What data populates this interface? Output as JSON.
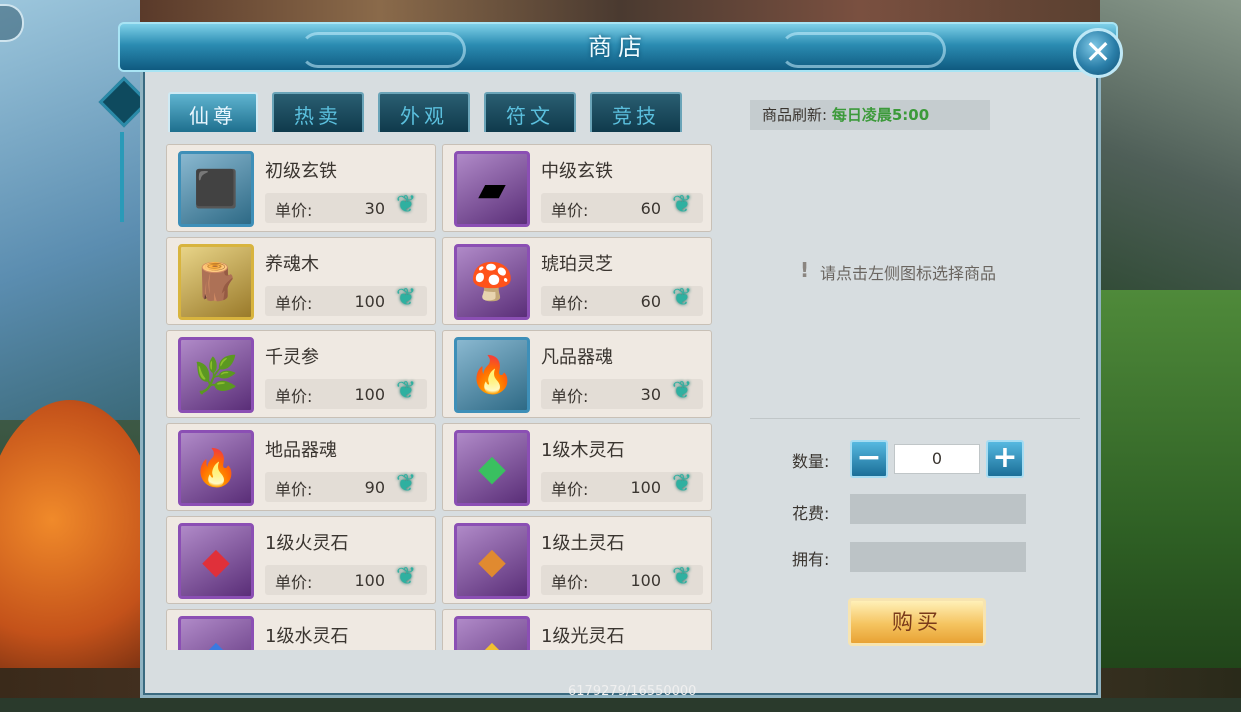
{
  "window": {
    "title": "商店",
    "close_glyph": "✕"
  },
  "tabs": [
    {
      "label": "仙尊",
      "active": true
    },
    {
      "label": "热卖",
      "active": false
    },
    {
      "label": "外观",
      "active": false
    },
    {
      "label": "符文",
      "active": false
    },
    {
      "label": "竞技",
      "active": false
    }
  ],
  "items": [
    {
      "name": "初级玄铁",
      "price_label": "单价:",
      "price": "30",
      "icon": "iron-ore-icon",
      "glyph": "⬛"
    },
    {
      "name": "中级玄铁",
      "price_label": "单价:",
      "price": "60",
      "icon": "iron-ingot-icon",
      "glyph": "▰"
    },
    {
      "name": "养魂木",
      "price_label": "单价:",
      "price": "100",
      "icon": "wood-icon",
      "glyph": "🪵"
    },
    {
      "name": "琥珀灵芝",
      "price_label": "单价:",
      "price": "60",
      "icon": "mushroom-icon",
      "glyph": "🍄"
    },
    {
      "name": "千灵参",
      "price_label": "单价:",
      "price": "100",
      "icon": "ginseng-icon",
      "glyph": "🌿"
    },
    {
      "name": "凡品器魂",
      "price_label": "单价:",
      "price": "30",
      "icon": "blue-flame-icon",
      "glyph": "🔥"
    },
    {
      "name": "地品器魂",
      "price_label": "单价:",
      "price": "90",
      "icon": "purple-flame-icon",
      "glyph": "🔥"
    },
    {
      "name": "1级木灵石",
      "price_label": "单价:",
      "price": "100",
      "icon": "green-gem-icon",
      "glyph": "◆"
    },
    {
      "name": "1级火灵石",
      "price_label": "单价:",
      "price": "100",
      "icon": "red-gem-icon",
      "glyph": "◆"
    },
    {
      "name": "1级土灵石",
      "price_label": "单价:",
      "price": "100",
      "icon": "orange-gem-icon",
      "glyph": "◆"
    },
    {
      "name": "1级水灵石",
      "price_label": "",
      "price": "",
      "icon": "blue-gem-icon",
      "glyph": "◆"
    },
    {
      "name": "1级光灵石",
      "price_label": "",
      "price": "",
      "icon": "yellow-gem-icon",
      "glyph": "◆"
    }
  ],
  "currency_glyph": "❦",
  "right_panel": {
    "refresh_label": "商品刷新:",
    "refresh_value": "每日凌晨5:00",
    "hint_icon": "!",
    "hint": "请点击左侧图标选择商品",
    "quantity_label": "数量:",
    "quantity_value": "0",
    "minus_glyph": "−",
    "plus_glyph": "+",
    "cost_label": "花费:",
    "own_label": "拥有:",
    "buy_label": "购买"
  },
  "footer": {
    "counter": "6179279/16550000"
  },
  "colors": {
    "accent": "#2b8cb2",
    "buy_button": "#f5c460",
    "refresh_value": "#3c9a3a",
    "item_border_purple": "#8b4fb4",
    "item_border_blue": "#3e8fb8",
    "item_border_gold": "#d8b43e"
  }
}
